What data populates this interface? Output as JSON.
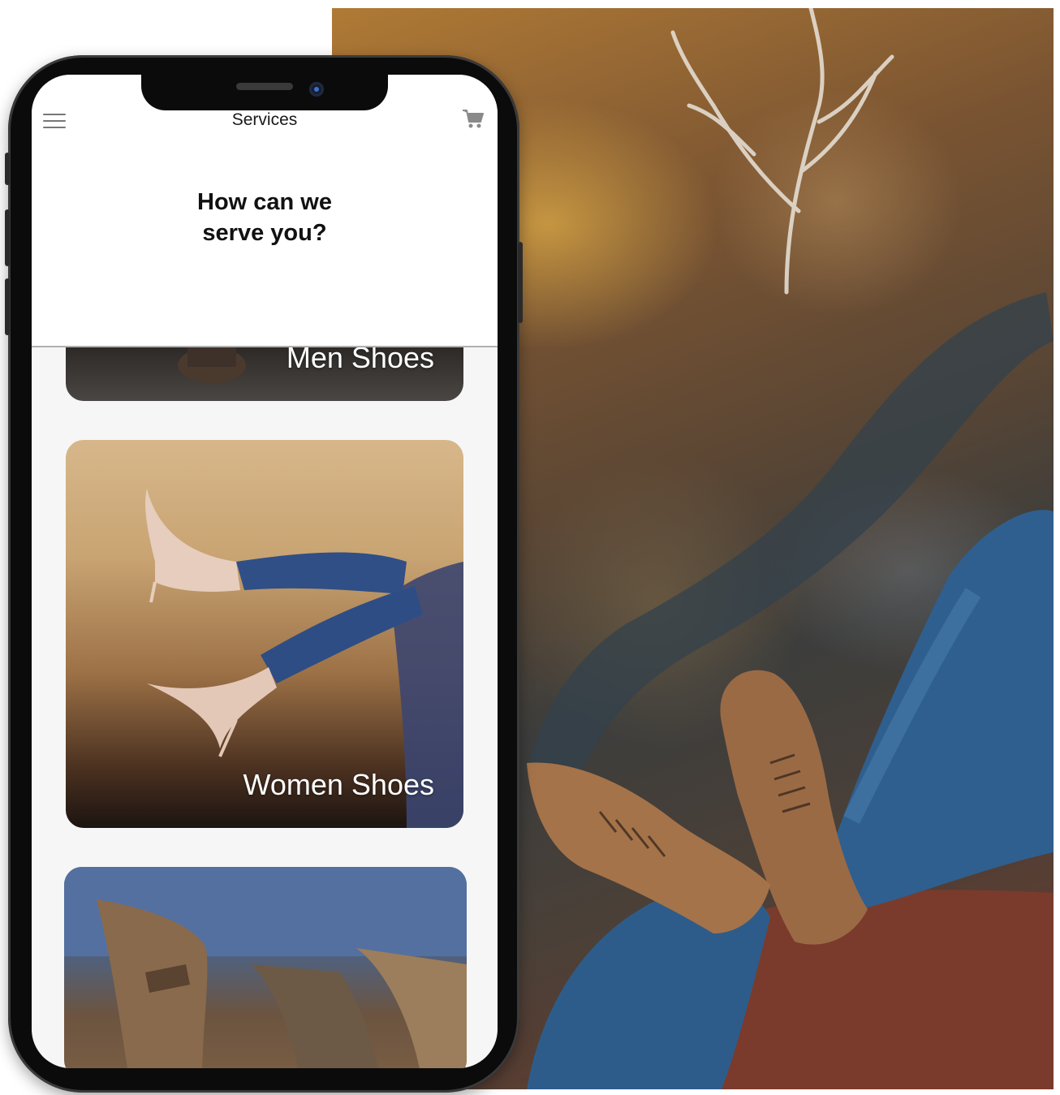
{
  "header": {
    "title": "Services",
    "headline_line1": "How can we",
    "headline_line2": "serve you?"
  },
  "icons": {
    "menu": "hamburger-menu-icon",
    "cart": "shopping-cart-icon"
  },
  "services": [
    {
      "label": "Men Shoes"
    },
    {
      "label": "Women Shoes"
    },
    {
      "label": ""
    }
  ],
  "colors": {
    "header_bg": "#ffffff",
    "screen_bg": "#f6f6f6",
    "icon_gray": "#777777",
    "phone_frame": "#0b0b0b"
  }
}
